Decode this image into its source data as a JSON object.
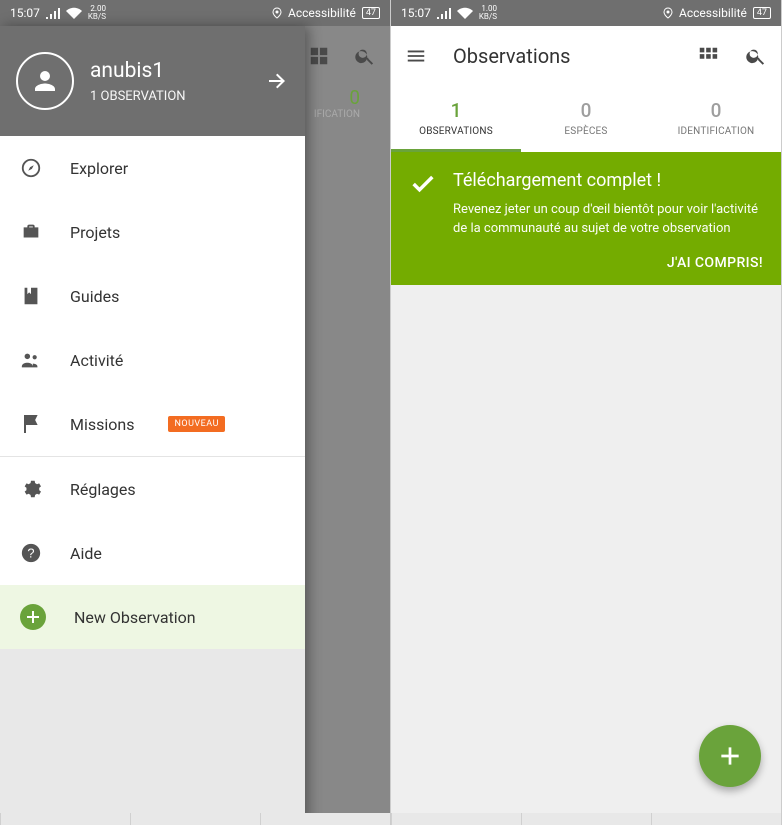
{
  "status": {
    "time": "15:07",
    "kbs_left": "2.00",
    "kbs_right": "1.00",
    "kbs_unit": "KB/S",
    "accessibility": "Accessibilité",
    "battery": "47"
  },
  "left": {
    "user": {
      "name": "anubis1",
      "obs_count_label": "1 OBSERVATION"
    },
    "behind": {
      "tab_count": "0",
      "tab_label_frag": "IFICATION"
    },
    "items": [
      {
        "label": "Explorer"
      },
      {
        "label": "Projets"
      },
      {
        "label": "Guides"
      },
      {
        "label": "Activité"
      },
      {
        "label": "Missions",
        "badge": "NOUVEAU"
      },
      {
        "label": "Réglages"
      },
      {
        "label": "Aide"
      }
    ],
    "footer": {
      "label": "New Observation"
    }
  },
  "right": {
    "title": "Observations",
    "tabs": [
      {
        "count": "1",
        "label": "OBSERVATIONS"
      },
      {
        "count": "0",
        "label": "ESPÈCES"
      },
      {
        "count": "0",
        "label": "IDENTIFICATION"
      }
    ],
    "banner": {
      "title": "Téléchargement complet !",
      "body": "Revenez jeter un coup d'œil bientôt pour voir l'activité de la communauté au sujet de votre observation",
      "action": "J'AI COMPRIS!"
    }
  }
}
